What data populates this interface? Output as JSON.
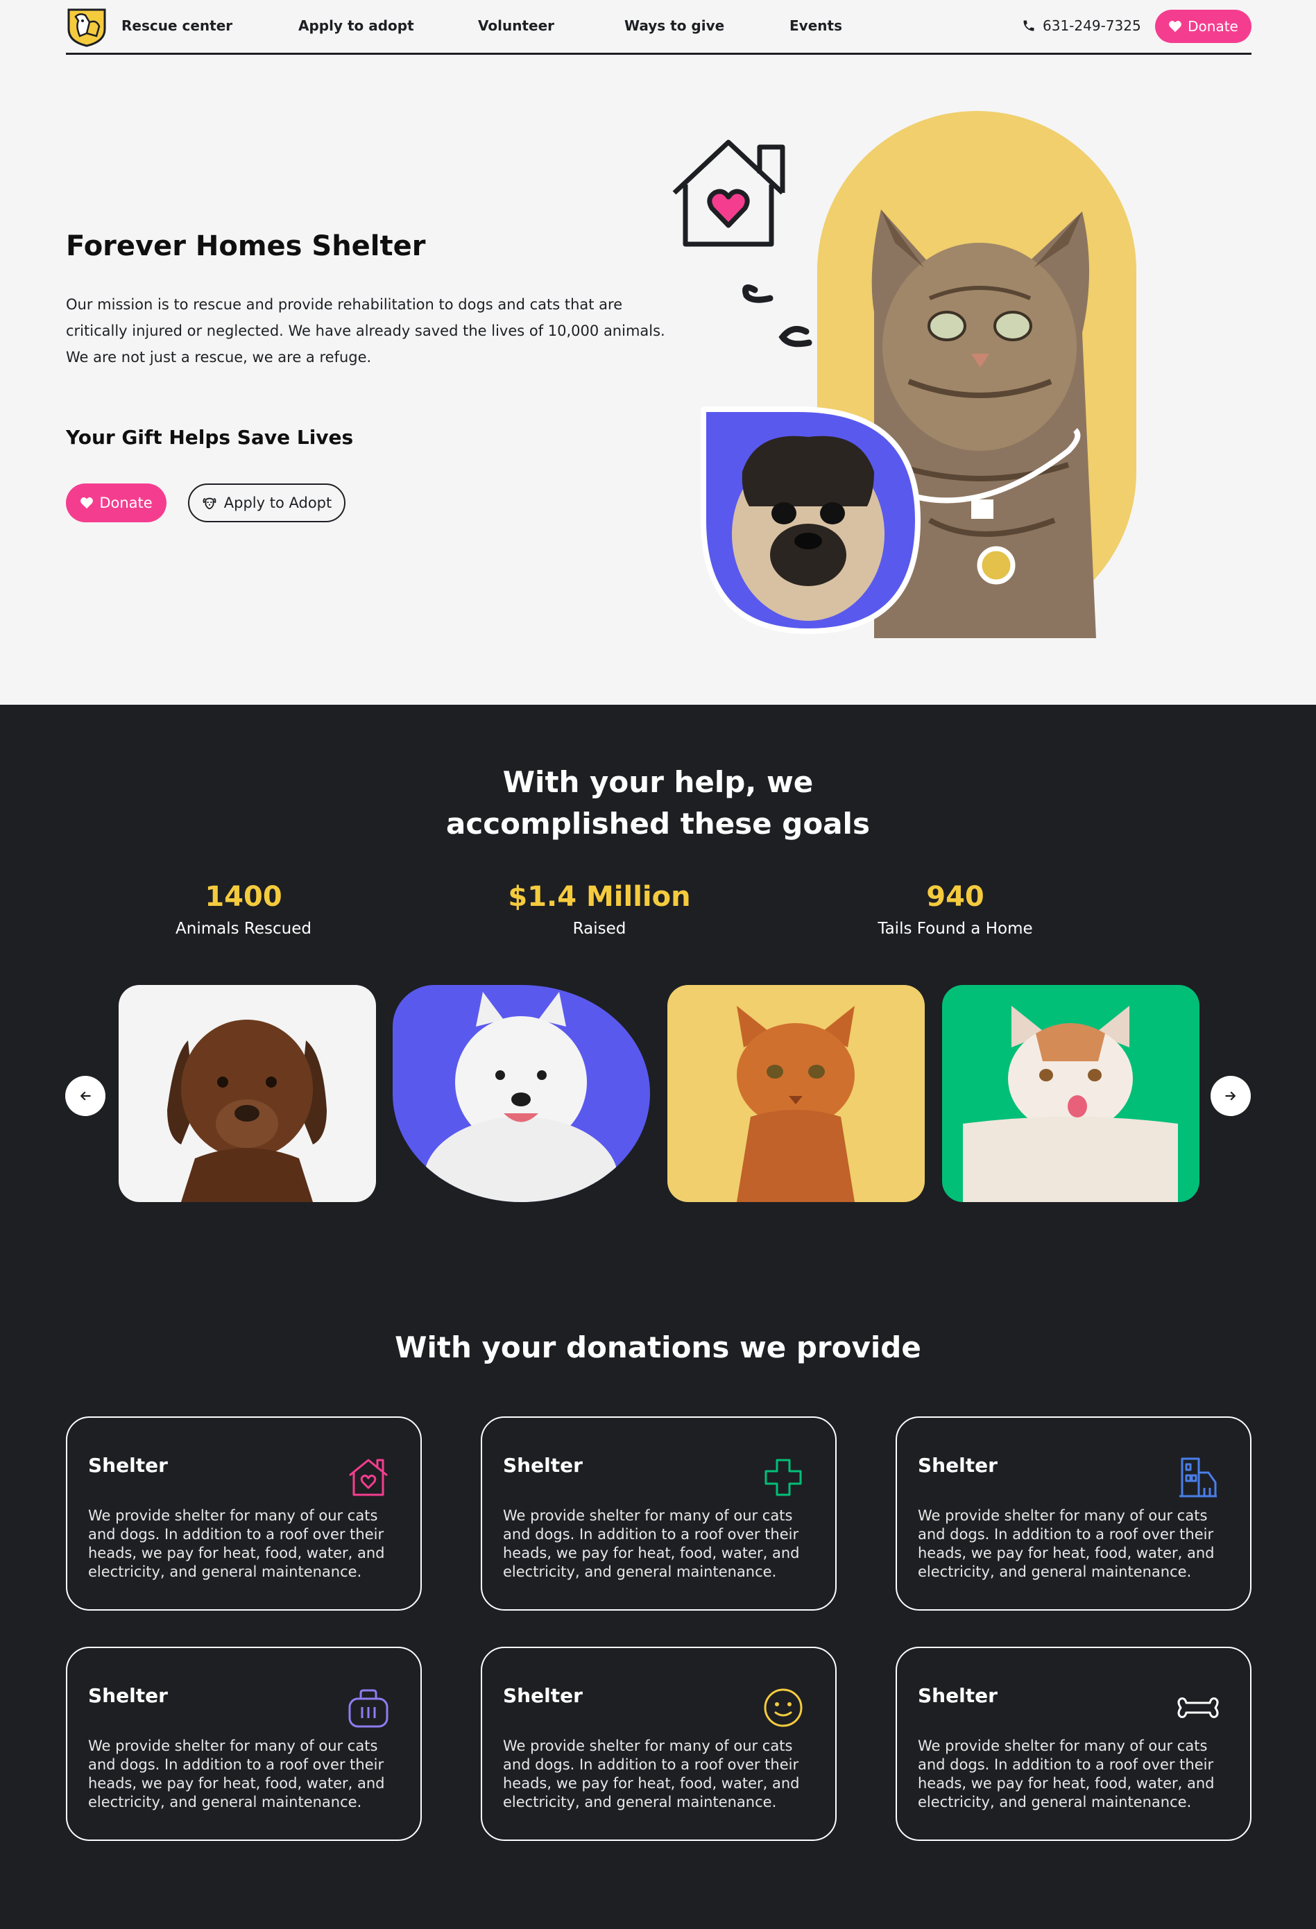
{
  "nav": {
    "links": [
      "Rescue center",
      "Apply to adopt",
      "Volunteer",
      "Ways to give",
      "Events"
    ],
    "phone": "631-249-7325",
    "donate_label": "Donate"
  },
  "hero": {
    "title": "Forever Homes Shelter",
    "text": "Our mission is to rescue and provide rehabilitation to dogs and cats that are critically injured or neglected. We have already saved the lives of 10,000 animals. We are not just a rescue, we are a refuge.",
    "subtitle": "Your Gift Helps Save Lives",
    "donate_label": "Donate",
    "adopt_label": "Apply to Adopt"
  },
  "goals": {
    "title_line1": "With your help, we",
    "title_line2": "accomplished these goals",
    "stats": [
      {
        "value": "1400",
        "label": "Animals Rescued"
      },
      {
        "value": "$1.4 Million",
        "label": "Raised"
      },
      {
        "value": "940",
        "label": "Tails Found a Home"
      }
    ]
  },
  "carousel": {
    "cards": [
      {
        "animal": "brown-dog",
        "bg": "#f4f4f4"
      },
      {
        "animal": "white-samoyed",
        "bg": "#5a59ee"
      },
      {
        "animal": "orange-cat",
        "bg": "#f0cf6c"
      },
      {
        "animal": "white-orange-cat",
        "bg": "#02bf78"
      }
    ]
  },
  "provide": {
    "title": "With your donations we provide",
    "cards": [
      {
        "title": "Shelter",
        "text": "We provide shelter for many of our cats and dogs. In addition to a roof over their heads, we pay for heat, food, water, and electricity, and general maintenance.",
        "icon": "house-heart-icon",
        "color": "#f53d8f"
      },
      {
        "title": "Shelter",
        "text": "We provide shelter for many of our cats and dogs. In addition to a roof over their heads, we pay for heat, food, water, and electricity, and general maintenance.",
        "icon": "medical-cross-icon",
        "color": "#02bf78"
      },
      {
        "title": "Shelter",
        "text": "We provide shelter for many of our cats and dogs. In addition to a roof over their heads, we pay for heat, food, water, and electricity, and general maintenance.",
        "icon": "building-icon",
        "color": "#4a7fe8"
      },
      {
        "title": "Shelter",
        "text": "We provide shelter for many of our cats and dogs. In addition to a roof over their heads, we pay for heat, food, water, and electricity, and general maintenance.",
        "icon": "pet-carrier-icon",
        "color": "#8f7cf0"
      },
      {
        "title": "Shelter",
        "text": "We provide shelter for many of our cats and dogs. In addition to a roof over their heads, we pay for heat, food, water, and electricity, and general maintenance.",
        "icon": "smiley-icon",
        "color": "#f5cb3e"
      },
      {
        "title": "Shelter",
        "text": "We provide shelter for many of our cats and dogs. In addition to a roof over their heads, we pay for heat, food, water, and electricity, and general maintenance.",
        "icon": "bone-icon",
        "color": "#ffffff"
      }
    ]
  }
}
